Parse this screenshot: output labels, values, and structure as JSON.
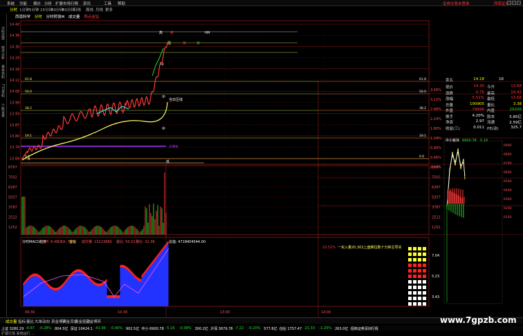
{
  "menu": {
    "items": [
      "系统",
      "功能",
      "报价",
      "分析",
      "扩展市场行情",
      "资讯",
      "工具",
      "帮助"
    ],
    "promo_left": "证券交易未登录",
    "promo_right": "西南证券"
  },
  "toolbar": {
    "items": [
      "分时",
      "1分钟",
      "5分钟",
      "15分钟",
      "30分钟",
      "60分钟",
      "日线",
      "周线",
      "月线",
      "更多"
    ],
    "active": "分时"
  },
  "title": {
    "name": "西南科学",
    "chart": "分时",
    "indicator": "分时转强M",
    "volume": "成交量",
    "extra": "两点金钻"
  },
  "left_strip": [
    "分时走势",
    "技术分析",
    "基本资料",
    "F10资料",
    "个股全景"
  ],
  "price_axis": {
    "left": [
      "14.42",
      "14.36",
      "14.30",
      "14.24",
      "14.18",
      "14.12",
      "14.06",
      "13.99",
      "13.93",
      "13.87",
      "13.80",
      "13.74",
      "13.68"
    ],
    "right": [
      "3.56%",
      "3.12%",
      "2.68%",
      "2.24%",
      "1.80%",
      "1.34%",
      "0.90%",
      "0.46%",
      "0.00%"
    ]
  },
  "fib_levels": [
    {
      "label": "61.8",
      "right": "61.8"
    },
    {
      "label": "50.0",
      "right": "50.0"
    },
    {
      "label": "38.2",
      "right": "38.2"
    },
    {
      "label": "19.1",
      "right": "19.1"
    },
    {
      "label": "0.0",
      "right": "0.0"
    }
  ],
  "chart_marks": {
    "high": "高",
    "hh": "HH",
    "strong": "强",
    "buy": "买",
    "sell": "卖",
    "mid": "中",
    "low": "低",
    "today_pressure": "当日压线",
    "a_label": "A",
    "b_label": "B",
    "purple_line": "支撑线"
  },
  "volume_axis": {
    "left": [
      "8767",
      "7502",
      "6287",
      "5057",
      "3787",
      "2522",
      "1252"
    ],
    "right": [
      "8767",
      "7502",
      "6287",
      "5057",
      "3787",
      "2522",
      "1252"
    ]
  },
  "macd": {
    "header": "分时MACD趋势",
    "values": [
      "DIF: 8.49",
      "DEA: 7.23",
      "金钻",
      "成交量: 15223880",
      "委比: 50.52",
      "量比: 32.38"
    ],
    "zoom": "总值: 4718404544.00",
    "signal": "一买入量20,302上盘推拉数十分钟主导买",
    "signal_value": "10.52%",
    "right_labels": [
      "7.04",
      "5.23",
      "3.43"
    ]
  },
  "xaxis": [
    "09:30",
    "10:30",
    "13:00",
    "14:00"
  ],
  "quote": {
    "header": {
      "label": "卖五",
      "price": "14.18",
      "vol": "16"
    },
    "rows": [
      {
        "l": "现价",
        "v": "14.35",
        "l2": "今开",
        "v2": "13.68"
      },
      {
        "l": "涨跌",
        "v": "0.75",
        "l2": "最高",
        "v2": "14.42"
      },
      {
        "l": "涨幅",
        "v": "5.51%",
        "l2": "最低",
        "v2": "13.68"
      },
      {
        "l": "总量",
        "v": "100905",
        "l2": "量比",
        "v2": "3.38"
      },
      {
        "l": "外盘",
        "v": "79696",
        "l2": "内盘",
        "v2": "29206"
      },
      {
        "l": "换手",
        "v": "4.20%",
        "l2": "股本",
        "v2": "5.85亿"
      },
      {
        "l": "净资",
        "v": "2.97",
        "l2": "流通",
        "v2": "2.59亿"
      },
      {
        "l": "收益(三)",
        "v": "0.011",
        "l2": "PE(动)",
        "v2": "325.7"
      }
    ],
    "mini_title": "中小板块",
    "mini_index": "6900.78",
    "mini_change": "5.16",
    "mini_axis": [
      "6900",
      "6800",
      "6700",
      "6600",
      "6500",
      "6400",
      "6300",
      "6200",
      "6100"
    ]
  },
  "bottom_tabs": [
    "成交量",
    "指标",
    "量比",
    "大单动向",
    "资金博弈",
    "资金流向",
    "资金驱动",
    "资金博弈"
  ],
  "status": {
    "items": [
      {
        "t": "上证 3280.29",
        "c": "wh"
      },
      {
        "t": "-8.87",
        "c": "dn"
      },
      {
        "t": "-0.28%",
        "c": "dn"
      },
      {
        "t": "804.5亿",
        "c": "wh"
      },
      {
        "t": "深证 10424.1",
        "c": "wh"
      },
      {
        "t": "-41.99",
        "c": "dn"
      },
      {
        "t": "-0.40%",
        "c": "dn"
      },
      {
        "t": "902.5亿",
        "c": "wh"
      },
      {
        "t": "中小 6900.78",
        "c": "wh"
      },
      {
        "t": "-5.16",
        "c": "dn"
      },
      {
        "t": "-0.08%",
        "c": "dn"
      },
      {
        "t": "300.2亿",
        "c": "wh"
      },
      {
        "t": "沪深 3679.78",
        "c": "wh"
      },
      {
        "t": "-7.22",
        "c": "dn"
      },
      {
        "t": "-0.20%",
        "c": "dn"
      },
      {
        "t": "577.6亿",
        "c": "wh"
      },
      {
        "t": "创业 1757.47",
        "c": "wh"
      },
      {
        "t": "-21.33",
        "c": "dn"
      },
      {
        "t": "-1.20%",
        "c": "dn"
      },
      {
        "t": "263.0亿",
        "c": "wh"
      },
      {
        "t": "招商证券深圳行情",
        "c": "wh"
      }
    ],
    "line2": "扩展行情  系统运行  ..."
  },
  "watermark": "www.7gpzb.com",
  "colors": {
    "up": "#ff3b3b",
    "down": "#22dd22",
    "price": "#ffffff",
    "avg": "#ffff66",
    "grid": "#8b1a1a"
  }
}
